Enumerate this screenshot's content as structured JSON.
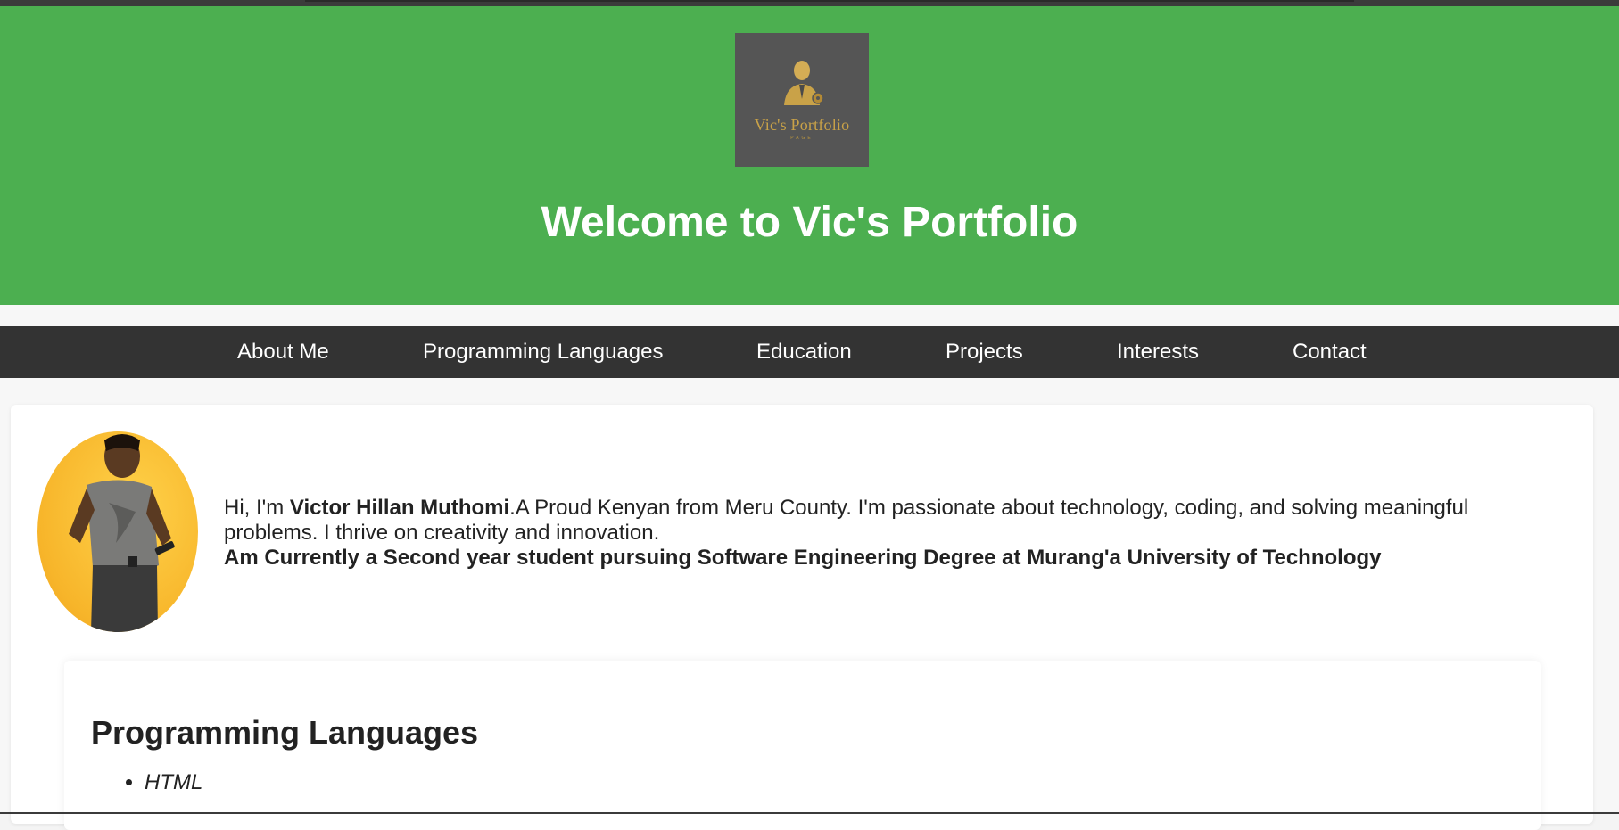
{
  "header": {
    "logo_text": "Vic's Portfolio",
    "logo_subtext": "PAGE",
    "title": "Welcome to Vic's Portfolio"
  },
  "nav": {
    "items": [
      {
        "label": "About Me"
      },
      {
        "label": "Programming Languages"
      },
      {
        "label": "Education"
      },
      {
        "label": "Projects"
      },
      {
        "label": "Interests"
      },
      {
        "label": "Contact"
      }
    ]
  },
  "about": {
    "greeting": "Hi, I'm ",
    "name": "Victor Hillan Muthomi",
    "description": ".A Proud Kenyan from Meru County. I'm passionate about technology, coding, and solving meaningful problems. I thrive on creativity and innovation.",
    "status": "Am Currently a Second year student pursuing Software Engineering Degree at Murang'a University of Technology"
  },
  "languages": {
    "heading": "Programming Languages",
    "items": [
      "HTML"
    ]
  },
  "colors": {
    "header_bg": "#4caf50",
    "nav_bg": "#333333",
    "logo_bg": "#555555",
    "logo_gold": "#c9a248"
  }
}
